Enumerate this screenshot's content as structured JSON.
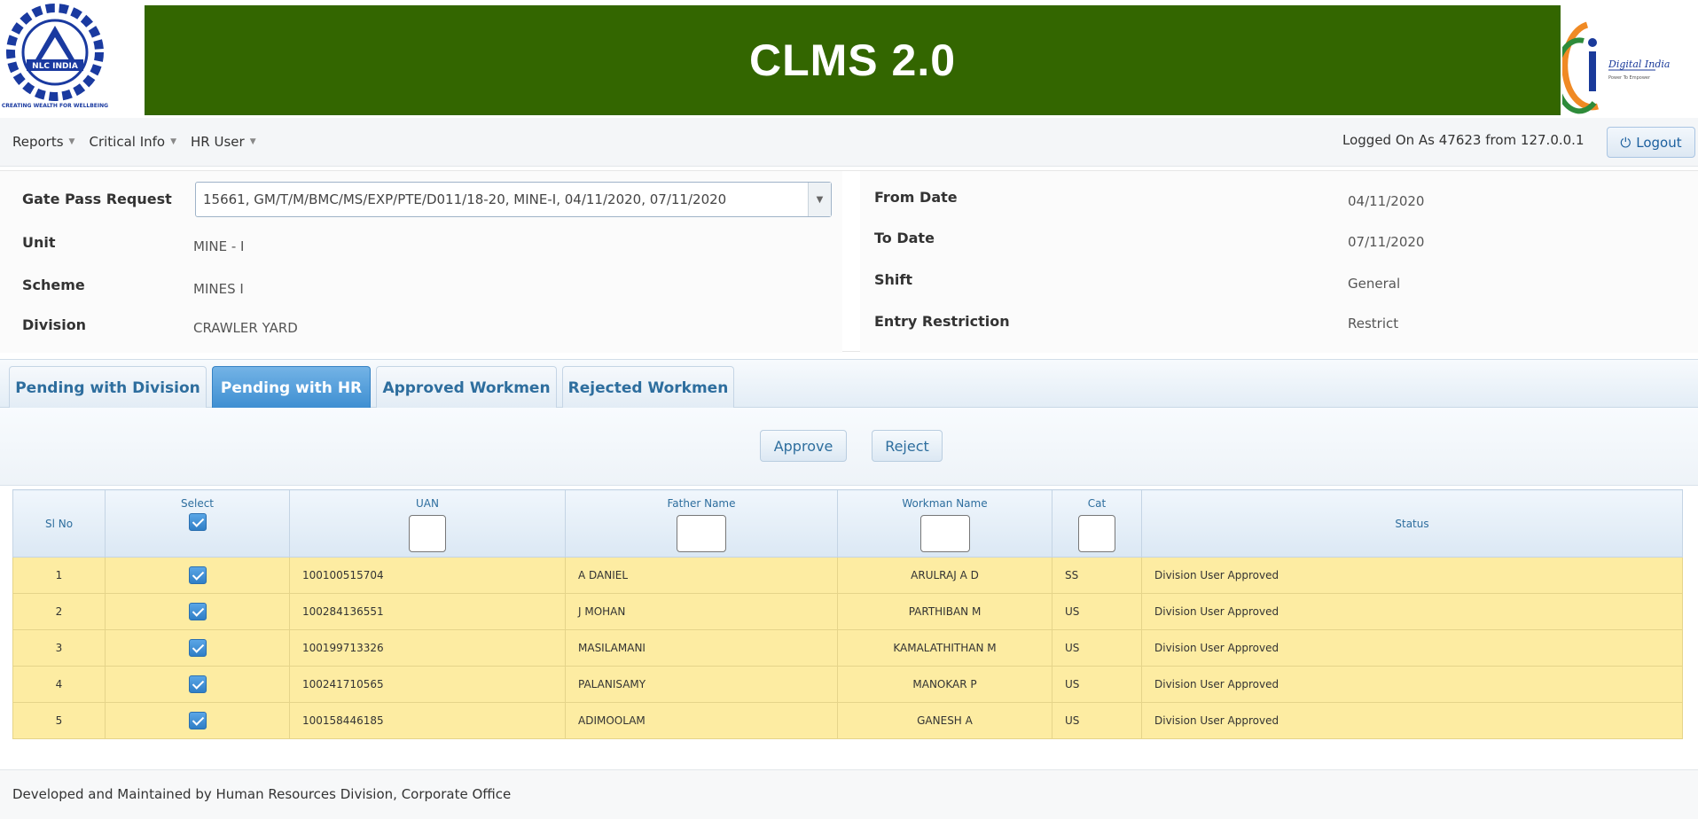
{
  "app": {
    "title": "CLMS 2.0",
    "left_logo_text": "NLC INDIA",
    "left_logo_tagline": "CREATING WEALTH FOR WELLBEING",
    "right_logo_text": "Digital India",
    "right_logo_tagline": "Power To Empower"
  },
  "nav": {
    "menus": [
      {
        "label": "Reports"
      },
      {
        "label": "Critical Info"
      },
      {
        "label": "HR User"
      }
    ],
    "logged_on": "Logged On As 47623 from  127.0.0.1",
    "logout_label": "Logout"
  },
  "request": {
    "gate_pass_label": "Gate Pass Request",
    "gate_pass_value": "15661, GM/T/M/BMC/MS/EXP/PTE/D011/18-20, MINE-I, 04/11/2020, 07/11/2020",
    "unit_label": "Unit",
    "unit_value": "MINE - I",
    "scheme_label": "Scheme",
    "scheme_value": "MINES I",
    "division_label": "Division",
    "division_value": "CRAWLER YARD",
    "from_date_label": "From Date",
    "from_date_value": "04/11/2020",
    "to_date_label": "To Date",
    "to_date_value": "07/11/2020",
    "shift_label": "Shift",
    "shift_value": "General",
    "entry_label": "Entry Restriction",
    "entry_value": "Restrict"
  },
  "tabs": [
    {
      "label": "Pending with Division",
      "active": false
    },
    {
      "label": "Pending with HR",
      "active": true
    },
    {
      "label": "Approved Workmen",
      "active": false
    },
    {
      "label": "Rejected Workmen",
      "active": false
    }
  ],
  "actions": {
    "approve_label": "Approve",
    "reject_label": "Reject"
  },
  "grid": {
    "columns": {
      "sl": "Sl No",
      "select": "Select",
      "uan": "UAN",
      "father": "Father Name",
      "workman": "Workman Name",
      "cat": "Cat",
      "status": "Status"
    },
    "rows": [
      {
        "sl": "1",
        "uan": "100100515704",
        "father": "A DANIEL",
        "workman": "ARULRAJ A D",
        "cat": "SS",
        "status": "Division User Approved"
      },
      {
        "sl": "2",
        "uan": "100284136551",
        "father": "J MOHAN",
        "workman": "PARTHIBAN M",
        "cat": "US",
        "status": "Division User Approved"
      },
      {
        "sl": "3",
        "uan": "100199713326",
        "father": "MASILAMANI",
        "workman": "KAMALATHITHAN M",
        "cat": "US",
        "status": "Division User Approved"
      },
      {
        "sl": "4",
        "uan": "100241710565",
        "father": "PALANISAMY",
        "workman": "MANOKAR P",
        "cat": "US",
        "status": "Division User Approved"
      },
      {
        "sl": "5",
        "uan": "100158446185",
        "father": "ADIMOOLAM",
        "workman": "GANESH A",
        "cat": "US",
        "status": "Division User Approved"
      }
    ]
  },
  "footer": {
    "text": "Developed and Maintained by Human Resources Division, Corporate Office"
  },
  "colors": {
    "banner": "#336600",
    "row_highlight": "#fdeca2",
    "active_tab": "#3d8ed1"
  }
}
